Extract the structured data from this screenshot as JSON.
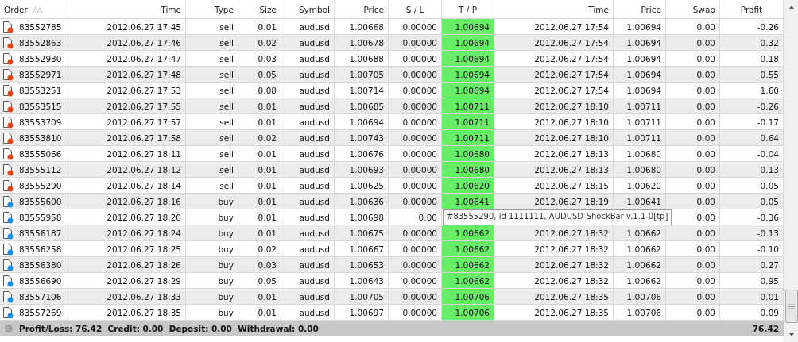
{
  "table": {
    "columns": [
      {
        "label": "Order",
        "sorted": true
      },
      {
        "label": "Time",
        "sorted": false
      },
      {
        "label": "Type",
        "sorted": false
      },
      {
        "label": "Size",
        "sorted": false
      },
      {
        "label": "Symbol",
        "sorted": false
      },
      {
        "label": "Price",
        "sorted": false
      },
      {
        "label": "S / L",
        "sorted": false
      },
      {
        "label": "T / P",
        "sorted": false
      },
      {
        "label": "Time",
        "sorted": false
      },
      {
        "label": "Price",
        "sorted": false
      },
      {
        "label": "Swap",
        "sorted": false
      },
      {
        "label": "Profit",
        "sorted": false
      }
    ],
    "rows": [
      {
        "color": "#e2441c",
        "cells": [
          "83552785",
          "2012.06.27 17:45",
          "sell",
          "0.01",
          "audusd",
          "1.00668",
          "0.00000",
          "1.00694",
          "2012.06.27 17:54",
          "1.00694",
          "0.00",
          "-0.26"
        ]
      },
      {
        "color": "#e2441c",
        "cells": [
          "83552863",
          "2012.06.27 17:46",
          "sell",
          "0.02",
          "audusd",
          "1.00678",
          "0.00000",
          "1.00694",
          "2012.06.27 17:54",
          "1.00694",
          "0.00",
          "-0.32"
        ]
      },
      {
        "color": "#e2441c",
        "cells": [
          "83552930",
          "2012.06.27 17:47",
          "sell",
          "0.03",
          "audusd",
          "1.00688",
          "0.00000",
          "1.00694",
          "2012.06.27 17:54",
          "1.00694",
          "0.00",
          "-0.18"
        ]
      },
      {
        "color": "#e2441c",
        "cells": [
          "83552971",
          "2012.06.27 17:48",
          "sell",
          "0.05",
          "audusd",
          "1.00705",
          "0.00000",
          "1.00694",
          "2012.06.27 17:54",
          "1.00694",
          "0.00",
          "0.55"
        ]
      },
      {
        "color": "#e2441c",
        "cells": [
          "83553251",
          "2012.06.27 17:53",
          "sell",
          "0.08",
          "audusd",
          "1.00714",
          "0.00000",
          "1.00694",
          "2012.06.27 17:54",
          "1.00694",
          "0.00",
          "1.60"
        ]
      },
      {
        "color": "#e2441c",
        "cells": [
          "83553515",
          "2012.06.27 17:55",
          "sell",
          "0.01",
          "audusd",
          "1.00685",
          "0.00000",
          "1.00711",
          "2012.06.27 18:10",
          "1.00711",
          "0.00",
          "-0.26"
        ]
      },
      {
        "color": "#e2441c",
        "cells": [
          "83553709",
          "2012.06.27 17:57",
          "sell",
          "0.01",
          "audusd",
          "1.00694",
          "0.00000",
          "1.00711",
          "2012.06.27 18:10",
          "1.00711",
          "0.00",
          "-0.17"
        ]
      },
      {
        "color": "#e2441c",
        "cells": [
          "83553810",
          "2012.06.27 17:58",
          "sell",
          "0.02",
          "audusd",
          "1.00743",
          "0.00000",
          "1.00711",
          "2012.06.27 18:10",
          "1.00711",
          "0.00",
          "0.64"
        ]
      },
      {
        "color": "#e2441c",
        "cells": [
          "83555066",
          "2012.06.27 18:11",
          "sell",
          "0.01",
          "audusd",
          "1.00676",
          "0.00000",
          "1.00680",
          "2012.06.27 18:13",
          "1.00680",
          "0.00",
          "-0.04"
        ]
      },
      {
        "color": "#e2441c",
        "cells": [
          "83555112",
          "2012.06.27 18:12",
          "sell",
          "0.01",
          "audusd",
          "1.00693",
          "0.00000",
          "1.00680",
          "2012.06.27 18:13",
          "1.00680",
          "0.00",
          "0.13"
        ]
      },
      {
        "color": "#e2441c",
        "cells": [
          "83555290",
          "2012.06.27 18:14",
          "sell",
          "0.01",
          "audusd",
          "1.00625",
          "0.00000",
          "1.00620",
          "2012.06.27 18:15",
          "1.00620",
          "0.00",
          "0.05"
        ]
      },
      {
        "color": "#1c8fe0",
        "cells": [
          "83555600",
          "2012.06.27 18:16",
          "buy",
          "0.01",
          "audusd",
          "1.00636",
          "0.00000",
          "1.00641",
          "2012.06.27 18:19",
          "1.00641",
          "0.00",
          "0.05"
        ]
      },
      {
        "color": "#1c8fe0",
        "cells": [
          "83555958",
          "2012.06.27 18:20",
          "buy",
          "0.01",
          "audusd",
          "1.00698",
          "0.00",
          null,
          null,
          null,
          "0.00",
          "-0.36"
        ]
      },
      {
        "color": "#1c8fe0",
        "cells": [
          "83556187",
          "2012.06.27 18:24",
          "buy",
          "0.01",
          "audusd",
          "1.00675",
          "0.00000",
          "1.00662",
          "2012.06.27 18:32",
          "1.00662",
          "0.00",
          "-0.13"
        ]
      },
      {
        "color": "#1c8fe0",
        "cells": [
          "83556258",
          "2012.06.27 18:25",
          "buy",
          "0.02",
          "audusd",
          "1.00667",
          "0.00000",
          "1.00662",
          "2012.06.27 18:32",
          "1.00662",
          "0.00",
          "-0.10"
        ]
      },
      {
        "color": "#1c8fe0",
        "cells": [
          "83556380",
          "2012.06.27 18:26",
          "buy",
          "0.03",
          "audusd",
          "1.00653",
          "0.00000",
          "1.00662",
          "2012.06.27 18:32",
          "1.00662",
          "0.00",
          "0.27"
        ]
      },
      {
        "color": "#1c8fe0",
        "cells": [
          "83556690",
          "2012.06.27 18:29",
          "buy",
          "0.05",
          "audusd",
          "1.00643",
          "0.00000",
          "1.00662",
          "2012.06.27 18:32",
          "1.00662",
          "0.00",
          "0.95"
        ]
      },
      {
        "color": "#1c8fe0",
        "cells": [
          "83557106",
          "2012.06.27 18:33",
          "buy",
          "0.01",
          "audusd",
          "1.00705",
          "0.00000",
          "1.00706",
          "2012.06.27 18:35",
          "1.00706",
          "0.00",
          "0.01"
        ]
      },
      {
        "color": "#1c8fe0",
        "cells": [
          "83557269",
          "2012.06.27 18:35",
          "buy",
          "0.01",
          "audusd",
          "1.00697",
          "0.00000",
          "1.00706",
          "2012.06.27 18:35",
          "1.00706",
          "0.00",
          "0.09"
        ]
      }
    ]
  },
  "tooltip": "#83555290, id 1111111, AUDUSD-ShockBar v.1.1-0[tp]",
  "status_bar": {
    "summary": "Profit/Loss: 76.42  Credit: 0.00  Deposit: 0.00  Withdrawal: 0.00",
    "total": "76.42"
  }
}
